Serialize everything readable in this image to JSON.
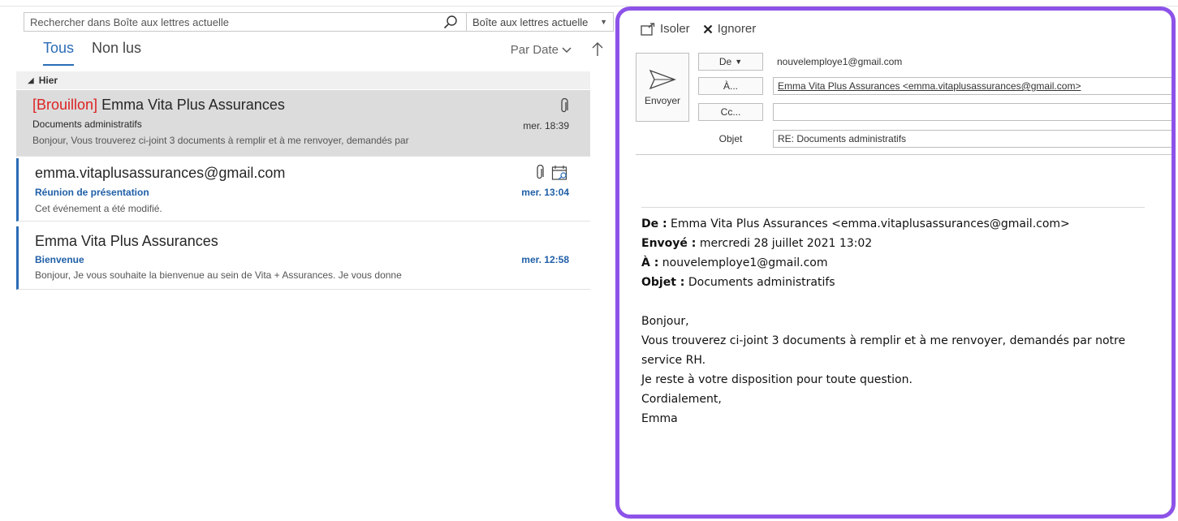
{
  "search": {
    "placeholder": "Rechercher dans Boîte aux lettres actuelle",
    "scope": "Boîte aux lettres actuelle"
  },
  "filters": {
    "tab_all": "Tous",
    "tab_unread": "Non lus",
    "sort_label": "Par Date"
  },
  "group": {
    "label": "Hier"
  },
  "messages": [
    {
      "draft_tag": "[Brouillon]",
      "sender": "Emma Vita Plus Assurances",
      "subject": "Documents administratifs",
      "time": "mer. 18:39",
      "preview": "Bonjour,  Vous trouverez ci-joint 3 documents à remplir et à me renvoyer, demandés par"
    },
    {
      "sender": "emma.vitaplusassurances@gmail.com",
      "subject": "Réunion de présentation",
      "time": "mer. 13:04",
      "preview": "Cet événement a été modifié."
    },
    {
      "sender": "Emma Vita Plus Assurances",
      "subject": "Bienvenue",
      "time": "mer. 12:58",
      "preview": "Bonjour,   Je vous souhaite la bienvenue au sein de Vita + Assurances.   Je vous donne"
    }
  ],
  "pane": {
    "toolbar": {
      "popout": "Isoler",
      "discard": "Ignorer"
    },
    "compose": {
      "send": "Envoyer",
      "from_btn": "De",
      "from_value": "nouvelemploye1@gmail.com",
      "to_btn": "À...",
      "to_value": "Emma Vita Plus Assurances <emma.vitaplusassurances@gmail.com>",
      "cc_btn": "Cc...",
      "cc_value": "",
      "subject_label": "Objet",
      "subject_value": "RE: Documents administratifs"
    },
    "quoted": {
      "from_label": "De :",
      "from_value": "Emma Vita Plus Assurances <emma.vitaplusassurances@gmail.com>",
      "sent_label": "Envoyé :",
      "sent_value": "mercredi 28 juillet 2021 13:02",
      "to_label": "À :",
      "to_value": "nouvelemploye1@gmail.com",
      "subject_label": "Objet :",
      "subject_value": "Documents administratifs",
      "greeting": "Bonjour,",
      "line1": "Vous trouverez ci-joint 3 documents à remplir et à me renvoyer, demandés par notre service RH.",
      "line2": "Je reste à votre disposition pour toute question.",
      "closing": "Cordialement,",
      "signature": "Emma"
    }
  },
  "colors": {
    "accent": "#2b6cb6",
    "pane_border": "#8d53e8",
    "draft": "#dd2222",
    "selected_row": "#dcdcdc"
  }
}
